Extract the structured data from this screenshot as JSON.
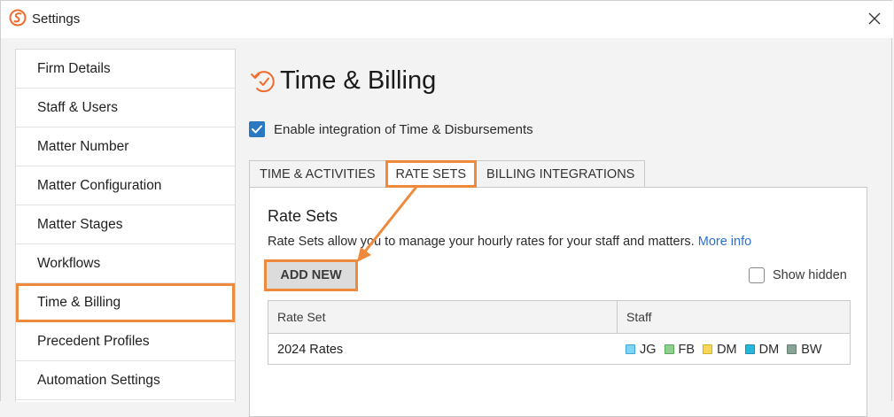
{
  "window": {
    "title": "Settings"
  },
  "sidebar": {
    "items": [
      {
        "label": "Firm Details"
      },
      {
        "label": "Staff & Users"
      },
      {
        "label": "Matter Number"
      },
      {
        "label": "Matter Configuration"
      },
      {
        "label": "Matter Stages"
      },
      {
        "label": "Workflows"
      },
      {
        "label": "Time & Billing",
        "active": true
      },
      {
        "label": "Precedent Profiles"
      },
      {
        "label": "Automation Settings"
      }
    ]
  },
  "main": {
    "title": "Time & Billing",
    "enable_integration": {
      "label": "Enable integration of Time & Disbursements",
      "checked": true
    },
    "tabs": [
      {
        "label": "TIME & ACTIVITIES"
      },
      {
        "label": "RATE SETS",
        "active": true
      },
      {
        "label": "BILLING INTEGRATIONS"
      }
    ],
    "rate_sets": {
      "title": "Rate Sets",
      "description": "Rate Sets allow you to manage your hourly rates for your staff and matters.",
      "more_info": "More info",
      "add_new_label": "ADD NEW",
      "show_hidden_label": "Show hidden",
      "columns": [
        "Rate Set",
        "Staff"
      ],
      "rows": [
        {
          "name": "2024 Rates",
          "staff": [
            {
              "initials": "JG",
              "color": "#7fd3f5",
              "border": "#3fa7d6"
            },
            {
              "initials": "FB",
              "color": "#8fcf8f",
              "border": "#5aa85a"
            },
            {
              "initials": "DM",
              "color": "#f5d85a",
              "border": "#d4b020"
            },
            {
              "initials": "DM",
              "color": "#26b6d9",
              "border": "#1a8fb0"
            },
            {
              "initials": "BW",
              "color": "#8aa397",
              "border": "#667f72"
            }
          ]
        }
      ]
    }
  },
  "colors": {
    "highlight": "#ef8a3c",
    "accent": "#2b78c2",
    "link": "#2c6fcf"
  }
}
